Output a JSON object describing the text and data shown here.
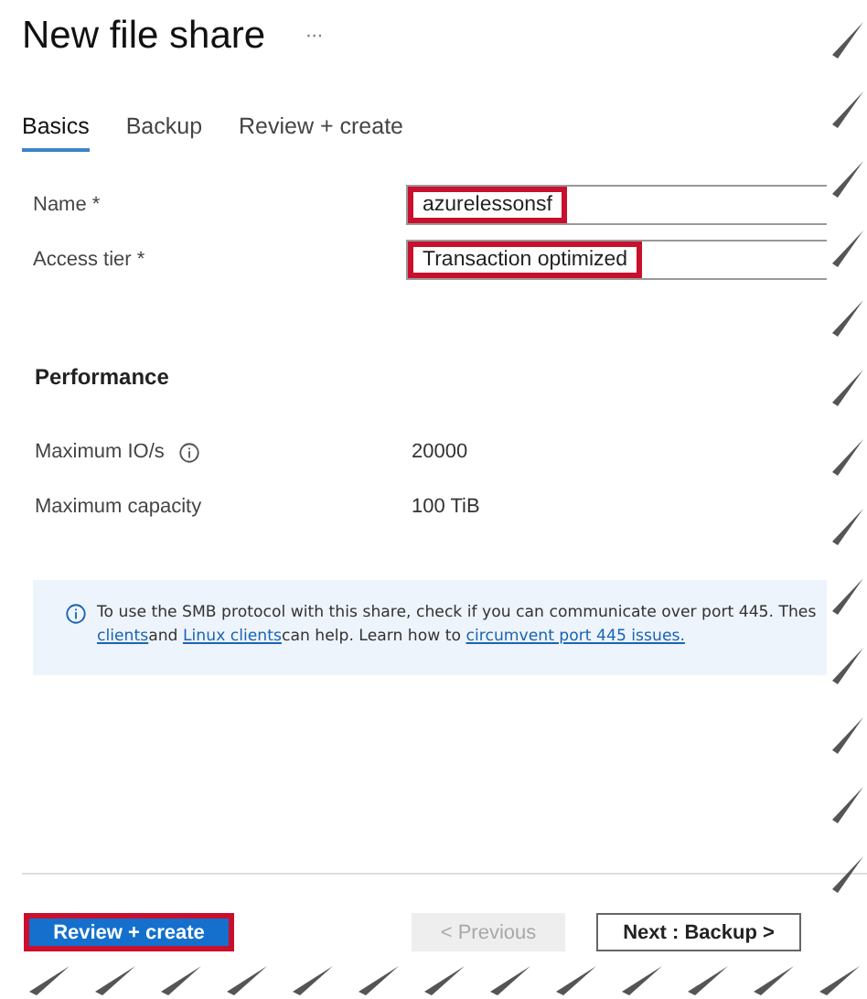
{
  "title": "New file share",
  "more_label": "···",
  "tabs": [
    {
      "label": "Basics",
      "selected": true
    },
    {
      "label": "Backup",
      "selected": false
    },
    {
      "label": "Review + create",
      "selected": false
    }
  ],
  "fields": [
    {
      "label": "Name *",
      "value": "azurelessonsf"
    },
    {
      "label": "Access tier *",
      "value": "Transaction optimized"
    }
  ],
  "performance": {
    "heading": "Performance",
    "rows": [
      {
        "label": "Maximum IO/s",
        "info": true,
        "value": "20000"
      },
      {
        "label": "Maximum capacity",
        "info": false,
        "value": "100 TiB"
      }
    ]
  },
  "notice": {
    "line_1": "To use the SMB protocol with this share, check if you can communicate over port 445. Thes",
    "link_1": "clients",
    "text_1": "and ",
    "link_2": "Linux clients",
    "text_2": "can help. Learn how to ",
    "link_3": "circumvent port 445 issues."
  },
  "buttons": [
    {
      "label": "Review + create",
      "kind": "primary"
    },
    {
      "label": "< Previous",
      "kind": "disabled"
    },
    {
      "label": "Next : Backup >",
      "kind": "secondary"
    }
  ]
}
